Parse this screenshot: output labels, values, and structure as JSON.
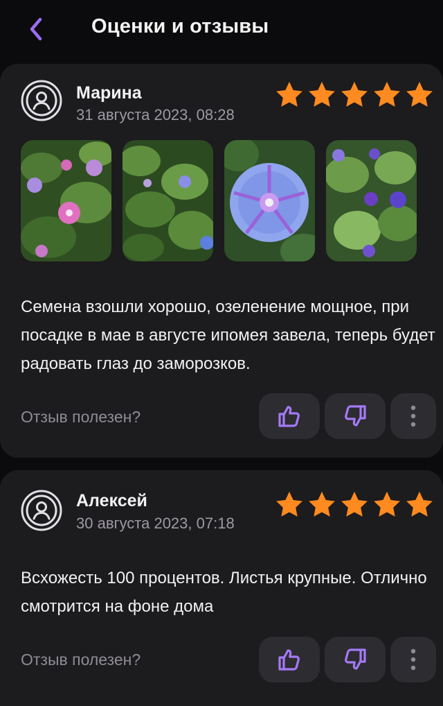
{
  "header": {
    "title": "Оценки и отзывы"
  },
  "colors": {
    "accent": "#9b6df2",
    "star": "#ff8a1f",
    "card": "#1c1b1e",
    "button": "#2d2c31"
  },
  "reviews": [
    {
      "author": "Марина",
      "date": "31 августа 2023, 08:28",
      "rating": 5,
      "photos": [
        "photo-1",
        "photo-2",
        "photo-3",
        "photo-4"
      ],
      "text": "Семена взошли хорошо, озеленение мощное, при посадке в мае в августе ипомея завела, теперь будет радовать глаз до заморозков.",
      "helpful_label": "Отзыв полезен?"
    },
    {
      "author": "Алексей",
      "date": "30 августа 2023, 07:18",
      "rating": 5,
      "text": "Всхожесть 100 процентов. Листья крупные. Отлично смотрится на фоне дома",
      "helpful_label": "Отзыв полезен?"
    }
  ],
  "icons": {
    "back": "chevron-left-icon",
    "avatar": "user-avatar-icon",
    "star": "star-icon",
    "like": "thumbs-up-icon",
    "dislike": "thumbs-down-icon",
    "more": "more-vertical-icon"
  }
}
